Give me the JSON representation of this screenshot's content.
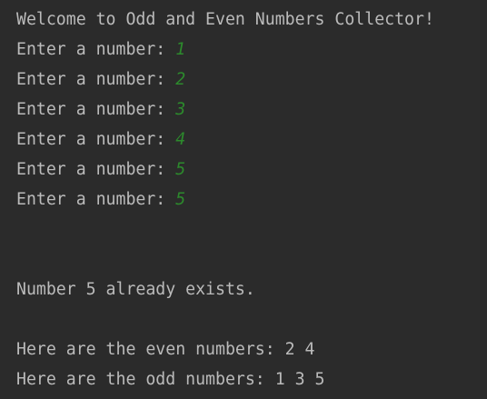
{
  "console": {
    "colors": {
      "background": "#2b2b2b",
      "output_text": "#bbbbbb",
      "user_input": "#2c8a2c"
    },
    "welcome": "Welcome to Odd and Even Numbers Collector!",
    "prompts": [
      {
        "prompt": "Enter a number: ",
        "input": "1"
      },
      {
        "prompt": "Enter a number: ",
        "input": "2"
      },
      {
        "prompt": "Enter a number: ",
        "input": "3"
      },
      {
        "prompt": "Enter a number: ",
        "input": "4"
      },
      {
        "prompt": "Enter a number: ",
        "input": "5"
      },
      {
        "prompt": "Enter a number: ",
        "input": "5"
      }
    ],
    "duplicate_message": "Number 5 already exists.",
    "even_result": "Here are the even numbers: 2 4",
    "odd_result": "Here are the odd numbers: 1 3 5"
  }
}
